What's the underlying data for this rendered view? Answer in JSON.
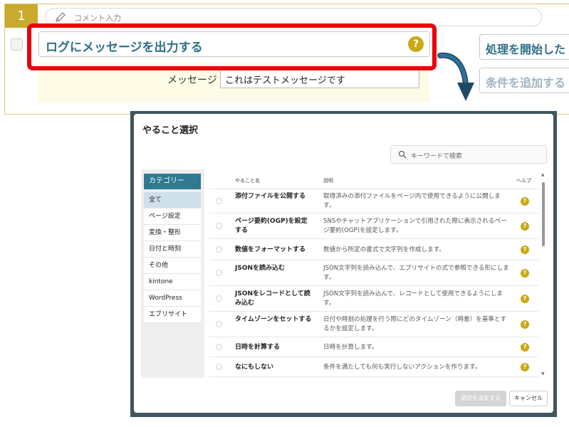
{
  "step": {
    "number": "1",
    "comment_placeholder": "コメント入力",
    "action_label": "ログにメッセージを出力する",
    "help_glyph": "?",
    "message_label": "メッセージ",
    "message_value": "これはテストメッセージです",
    "side_buttons": [
      "処理を開始した",
      "条件を追加する"
    ]
  },
  "modal": {
    "title": "やること選択",
    "search_placeholder": "キーワードで検索",
    "category_header": "カテゴリー",
    "categories": [
      "全て",
      "ページ設定",
      "変換・整形",
      "日付と時刻",
      "その他",
      "kintone",
      "WordPress",
      "エブリサイト"
    ],
    "columns": {
      "name": "やること名",
      "desc": "説明",
      "help": "ヘルプ"
    },
    "rows": [
      {
        "name": "添付ファイルを公開する",
        "desc": "取得済みの添付ファイルをページ内で使用できるように公開します。"
      },
      {
        "name": "ページ要約(OGP)を設定する",
        "desc": "SNSやチャットアプリケーションで引用された際に表示されるページ要約(OGP)を設定します。"
      },
      {
        "name": "数値をフォーマットする",
        "desc": "数値から所定の書式で文字列を作成します。"
      },
      {
        "name": "JSONを読み込む",
        "desc": "JSON文字列を読み込んで、エブリサイトの式で参照できる形にします。"
      },
      {
        "name": "JSONをレコードとして読み込む",
        "desc": "JSON文字列を読み込んで、レコードとして使用できるようにします。"
      },
      {
        "name": "タイムゾーンをセットする",
        "desc": "日付や時刻の処理を行う際にどのタイムゾーン（時差）を基準とするかを設定します。"
      },
      {
        "name": "日時を計算する",
        "desc": "日時を計算します。"
      },
      {
        "name": "なにもしない",
        "desc": "条件を満たしても何も実行しないアクションを作ります。"
      }
    ],
    "confirm_button": "選択を決定する",
    "cancel_button": "キャンセル"
  },
  "colors": {
    "accent": "#2e7a90",
    "help": "#c9a914",
    "highlight": "#e8000b",
    "step": "#c9a92e"
  }
}
